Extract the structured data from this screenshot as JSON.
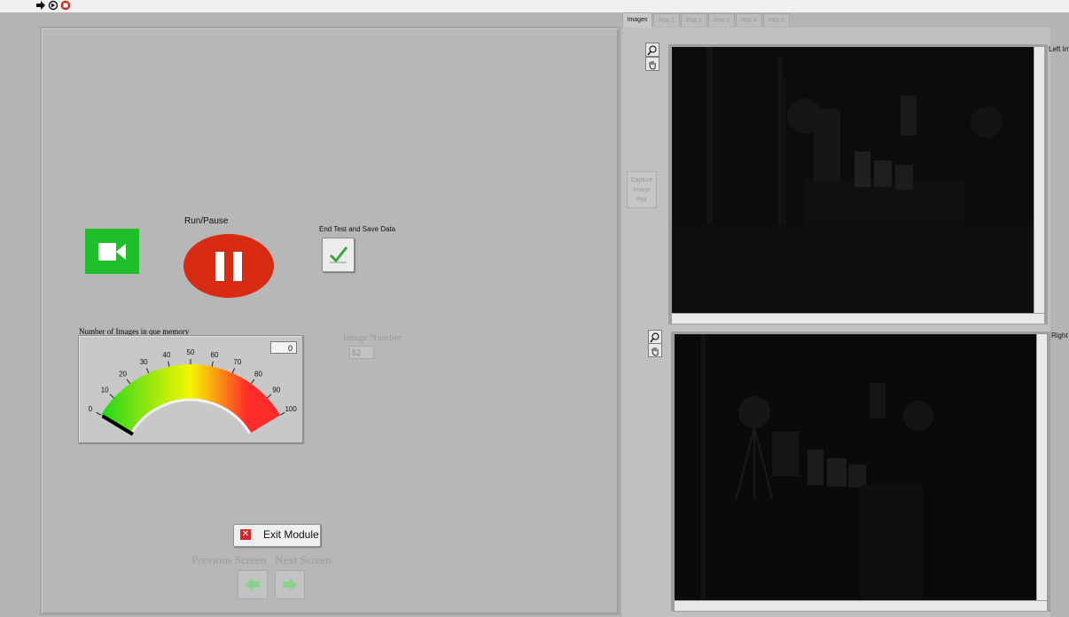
{
  "toolbar": {
    "icons": [
      "run-arrow-icon",
      "run-continuous-icon",
      "abort-icon"
    ]
  },
  "left_panel": {
    "camera_button_icon": "video-camera-icon",
    "run_pause": {
      "label": "Run/Pause",
      "state_icon": "pause-icon",
      "color": "#d92a14"
    },
    "end_test": {
      "label": "End Test and Save Data",
      "icon": "checkmark-icon"
    },
    "gauge": {
      "label": "Number of Images in que memory",
      "value": "0",
      "ticks": [
        "0",
        "10",
        "20",
        "30",
        "40",
        "50",
        "60",
        "70",
        "80",
        "90",
        "100"
      ],
      "min": 0,
      "max": 100,
      "current": 0,
      "colors": [
        "#22d61e",
        "#f6f600",
        "#ff2a2a"
      ]
    },
    "image_number": {
      "label": "Image Number",
      "value": "52"
    },
    "exit_button": {
      "label": "Exit Module",
      "icon": "close-x-icon"
    },
    "previous_screen": {
      "label": "Previous Screen",
      "icon": "left-arrow-icon"
    },
    "next_screen": {
      "label": "Next Screen",
      "icon": "right-arrow-icon"
    }
  },
  "right_panel": {
    "tabs": [
      {
        "label": "Images",
        "active": true
      },
      {
        "label": "Plot 1",
        "active": false
      },
      {
        "label": "Plot 2",
        "active": false
      },
      {
        "label": "Plot 3",
        "active": false
      },
      {
        "label": "Plot 4",
        "active": false
      },
      {
        "label": "Plot 5",
        "active": false
      }
    ],
    "capture_button": {
      "label_lines": [
        "Capture",
        "Image",
        "Pair"
      ]
    },
    "left_image": {
      "side_label": "Left Im",
      "tool_icons": [
        "zoom-icon",
        "pan-hand-icon"
      ]
    },
    "right_image": {
      "side_label": "Right",
      "tool_icons": [
        "zoom-icon",
        "pan-hand-icon"
      ]
    }
  }
}
